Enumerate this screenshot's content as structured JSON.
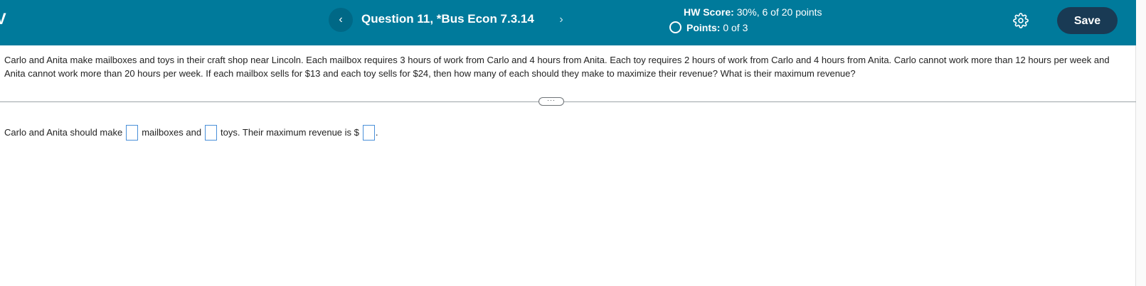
{
  "header": {
    "left_mark": "V",
    "question_title": "Question 11, *Bus Econ 7.3.14",
    "prev_glyph": "‹",
    "next_glyph": "›",
    "hw_score_label": "HW Score:",
    "hw_score_value": "30%, 6 of 20 points",
    "points_label": "Points:",
    "points_value": "0 of 3",
    "settings_icon": "gear-icon",
    "save_label": "Save",
    "colors": {
      "bar": "#007a9b",
      "save_button": "#193a54"
    }
  },
  "problem": {
    "text": "Carlo and Anita make mailboxes and toys in their craft shop near Lincoln. Each mailbox requires 3 hours of work from Carlo and 4 hours from Anita. Each toy requires 2 hours of work from Carlo and 4 hours from Anita. Carlo cannot work more than 12 hours per week and Anita cannot work more than 20 hours per week. If each mailbox sells for $13 and each toy sells for $24, then how many of each should they make to maximize their revenue? What is their maximum revenue?"
  },
  "divider": {
    "handle_glyph": "···"
  },
  "answer": {
    "part1": "Carlo and Anita should make",
    "part2": "mailboxes and",
    "part3": "toys. Their maximum revenue is $",
    "part4": ".",
    "mailboxes_value": "",
    "toys_value": "",
    "revenue_value": ""
  }
}
